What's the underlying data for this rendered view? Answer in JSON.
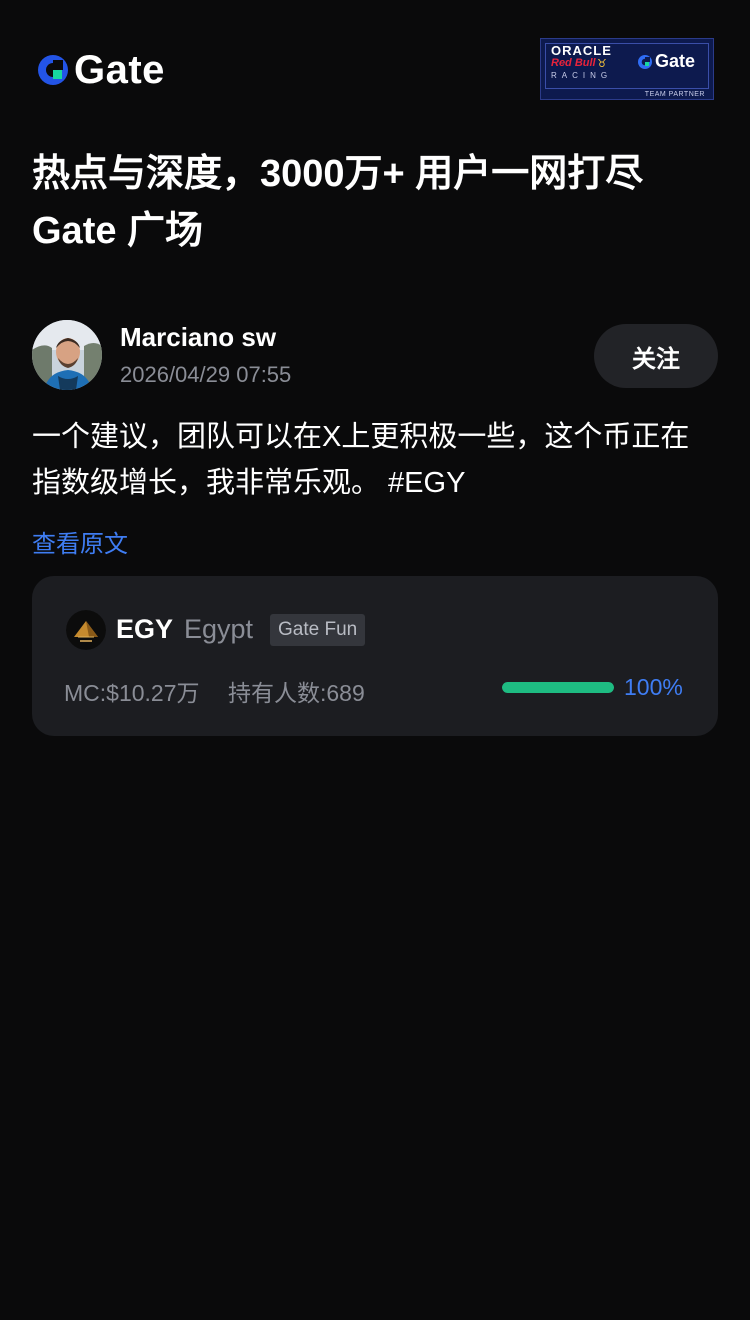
{
  "brand": {
    "logo_text": "Gate",
    "accent": "#2354e6"
  },
  "partner_badge": {
    "oracle": "ORACLE",
    "redbull": "Red Bull",
    "racing": "RACING",
    "gate": "Gate",
    "team_partner": "TEAM PARTNER"
  },
  "headline": {
    "line1": "热点与深度，3000万+ 用户一网打尽",
    "line2": "Gate 广场"
  },
  "post": {
    "author_name": "Marciano sw",
    "timestamp": "2026/04/29 07:55",
    "follow_label": "关注",
    "text_line1": "一个建议，团队可以在X上更积极一些，这个币正在",
    "text_line2": "指数级增长，我非常乐观。 #EGY",
    "view_original_label": "查看原文"
  },
  "token": {
    "symbol": "EGY",
    "name": "Egypt",
    "badge": "Gate Fun",
    "market_cap": "MC:$10.27万",
    "holders": "持有人数:689",
    "progress_label": "100%",
    "progress_fraction": 1.0,
    "progress_color": "#1ebc82",
    "progress_label_color": "#3f7df3"
  }
}
